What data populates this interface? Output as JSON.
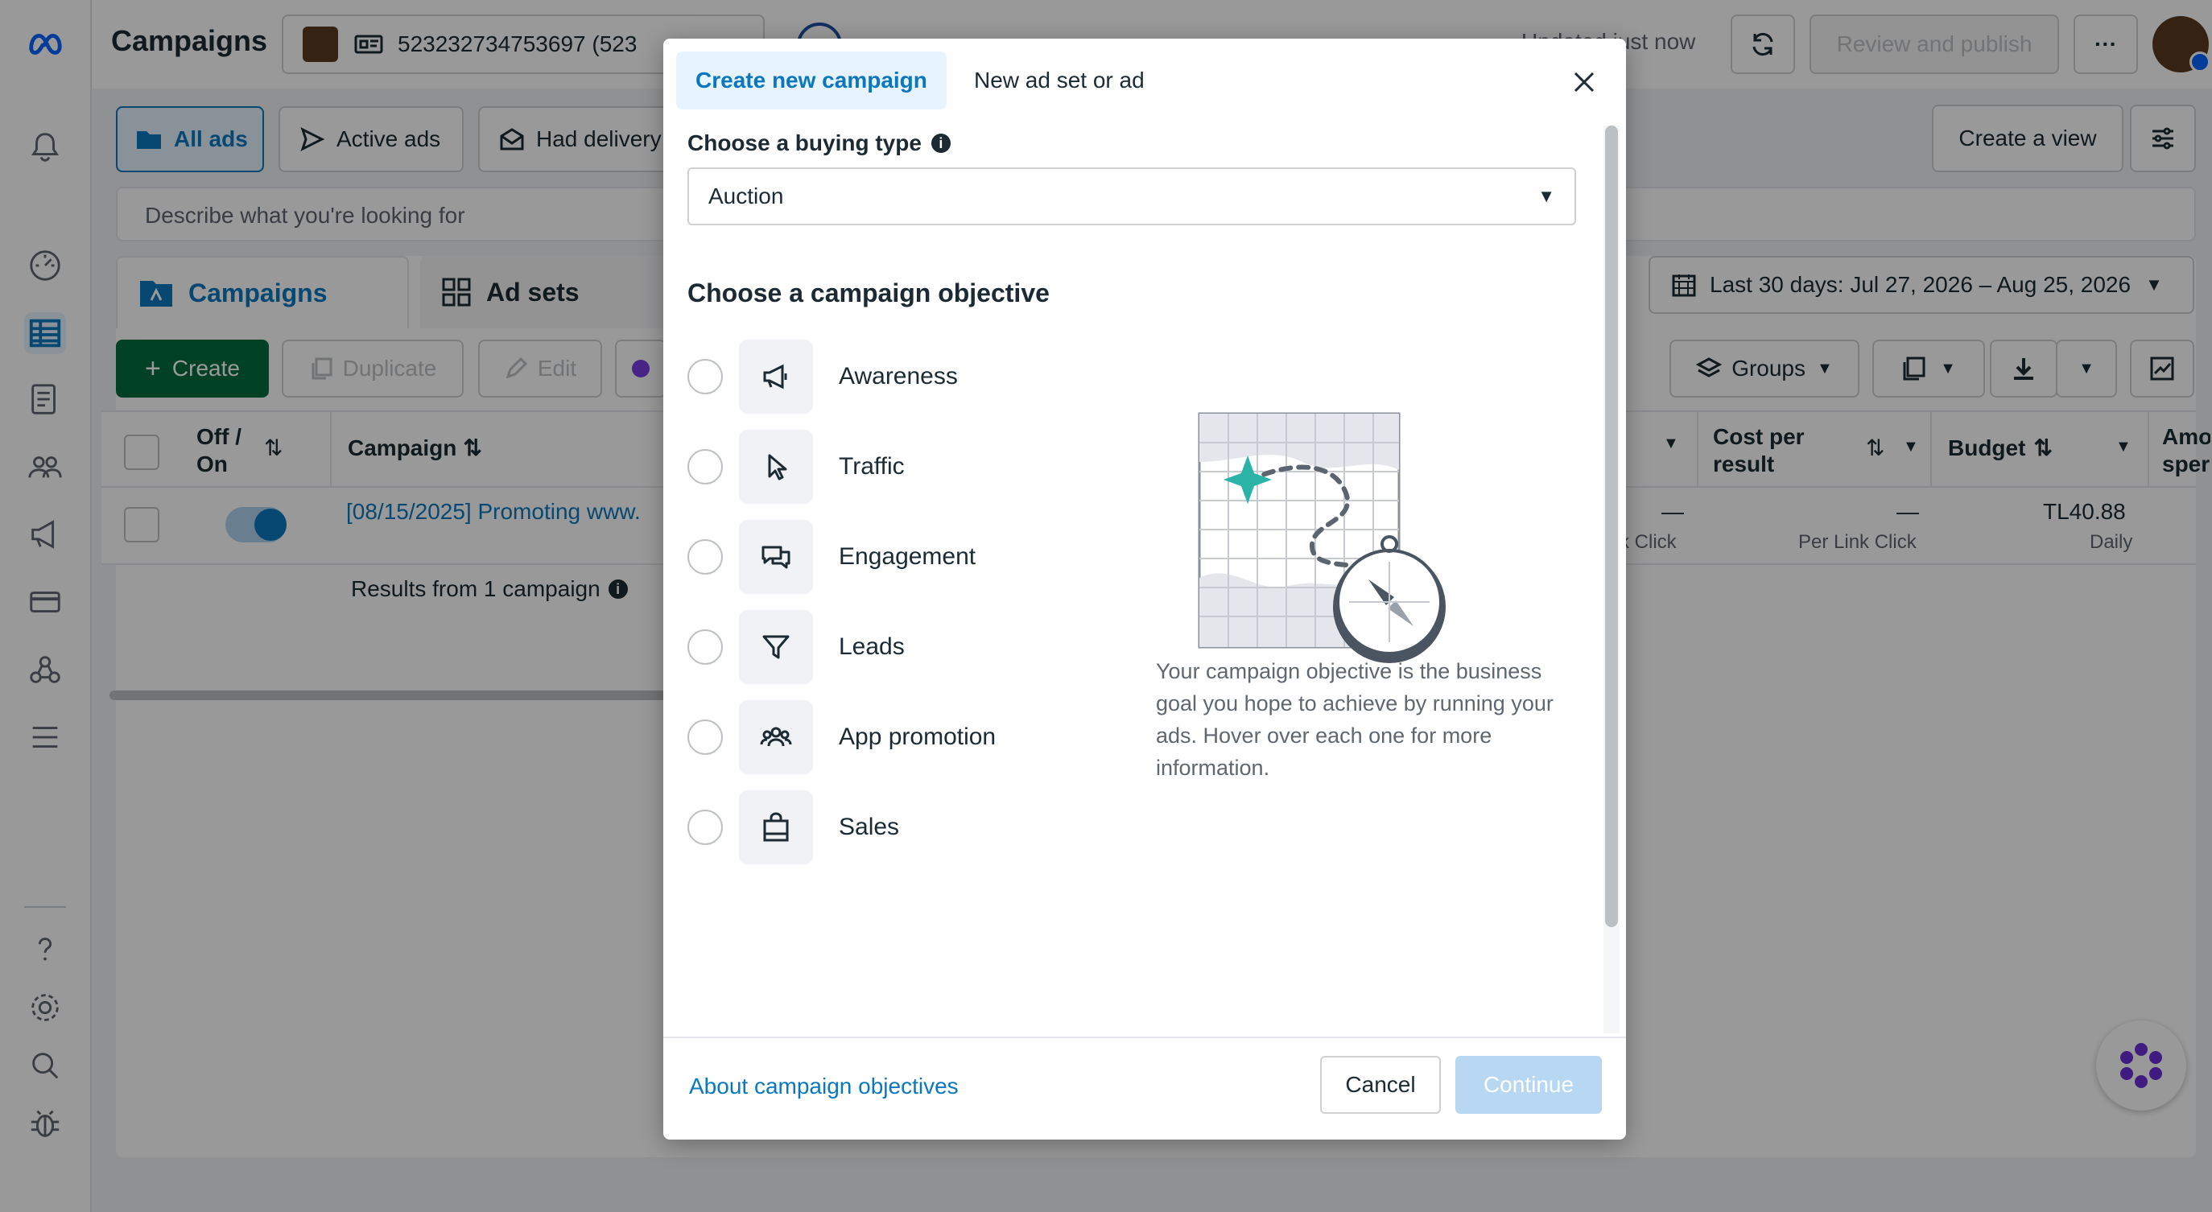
{
  "topbar": {
    "page_title": "Campaigns",
    "account_id": "523232734753697 (523",
    "updated_text": "Updated just now",
    "review_publish": "Review and publish",
    "more": "···"
  },
  "filters": {
    "all_ads": "All ads",
    "active_ads": "Active ads",
    "had_delivery": "Had delivery",
    "create_view": "Create a view",
    "search_placeholder": "Describe what you're looking for",
    "date_range": "Last 30 days: Jul 27, 2026 – Aug 25, 2026"
  },
  "tabs": {
    "campaigns": "Campaigns",
    "ad_sets": "Ad sets"
  },
  "toolbar": {
    "create": "Create",
    "duplicate": "Duplicate",
    "edit": "Edit",
    "groups": "Groups"
  },
  "table": {
    "headers": {
      "off_on": "Off / On",
      "campaign": "Campaign",
      "cost_per_result": "Cost per result",
      "budget": "Budget",
      "amount_spent": "Amo sper"
    },
    "row": {
      "campaign_name": "[08/15/2025] Promoting www.",
      "dash1": "—",
      "link_click_partial": "k Click",
      "dash2": "—",
      "per_link_click": "Per Link Click",
      "budget": "TL40.88",
      "budget_period": "Daily"
    },
    "results_text": "Results from 1 campaign"
  },
  "modal": {
    "tab_create": "Create new campaign",
    "tab_new_adset": "New ad set or ad",
    "buying_type_label": "Choose a buying type",
    "buying_type_value": "Auction",
    "objective_heading": "Choose a campaign objective",
    "objectives": [
      {
        "label": "Awareness",
        "icon": "megaphone-icon"
      },
      {
        "label": "Traffic",
        "icon": "cursor-icon"
      },
      {
        "label": "Engagement",
        "icon": "chat-bubbles-icon"
      },
      {
        "label": "Leads",
        "icon": "funnel-icon"
      },
      {
        "label": "App promotion",
        "icon": "people-icon"
      },
      {
        "label": "Sales",
        "icon": "shopping-bag-icon"
      }
    ],
    "description": "Your campaign objective is the business goal you hope to achieve by running your ads. Hover over each one for more information.",
    "about_link": "About campaign objectives",
    "cancel": "Cancel",
    "continue": "Continue"
  },
  "colors": {
    "brand_blue": "#0a78be",
    "create_green": "#006b3c",
    "continue_disabled": "#b7d7f3",
    "tab_active_bg": "#e7f3ff"
  }
}
